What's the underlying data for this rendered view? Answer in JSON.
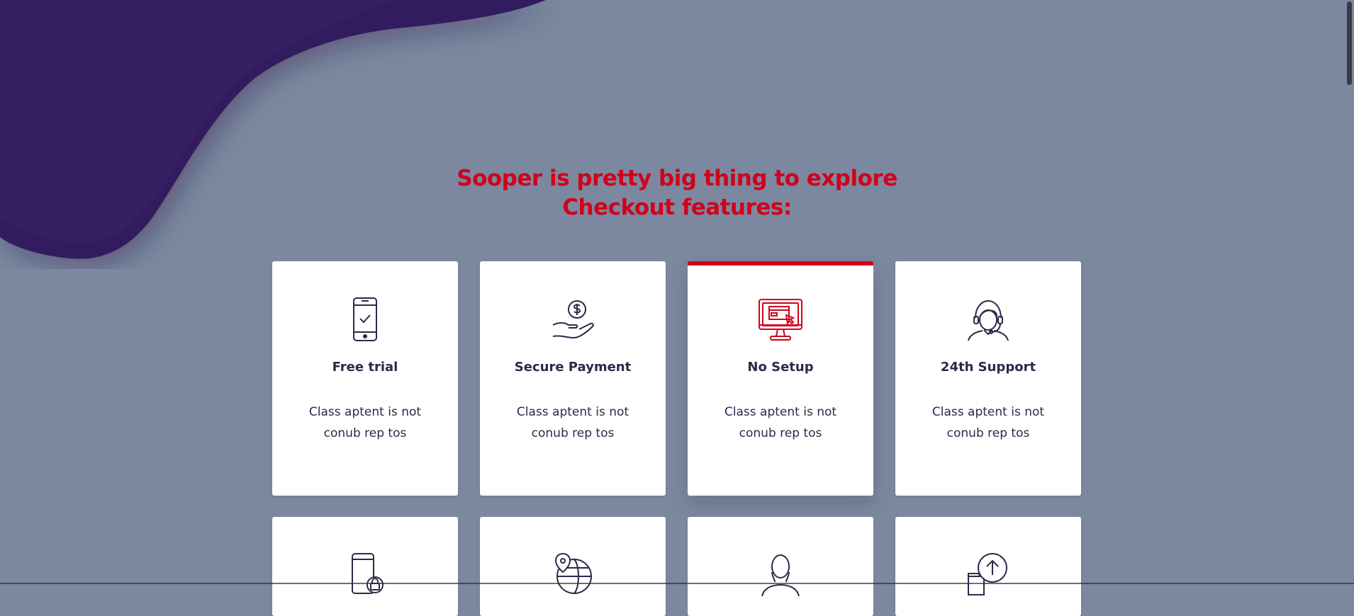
{
  "colors": {
    "background": "#7c88a0",
    "accent": "#d0021b",
    "blob": "#331c5e",
    "card": "#ffffff",
    "text": "#2a2a4a"
  },
  "section": {
    "title_line1": "Sooper is pretty big thing to explore",
    "title_line2": "Checkout features:"
  },
  "features": [
    {
      "title": "Free trial",
      "desc": "Class aptent is not conub rep tos",
      "icon": "smartphone-check-icon"
    },
    {
      "title": "Secure Payment",
      "desc": "Class aptent is not conub rep tos",
      "icon": "hand-coin-icon"
    },
    {
      "title": "No Setup",
      "desc": "Class aptent is not conub rep tos",
      "icon": "monitor-click-icon",
      "active": true
    },
    {
      "title": "24th Support",
      "desc": "Class aptent is not conub rep tos",
      "icon": "support-agent-icon"
    }
  ],
  "features_row2_icons": [
    "mobile-lock-icon",
    "globe-location-icon",
    "user-profile-icon",
    "upload-folder-icon"
  ]
}
